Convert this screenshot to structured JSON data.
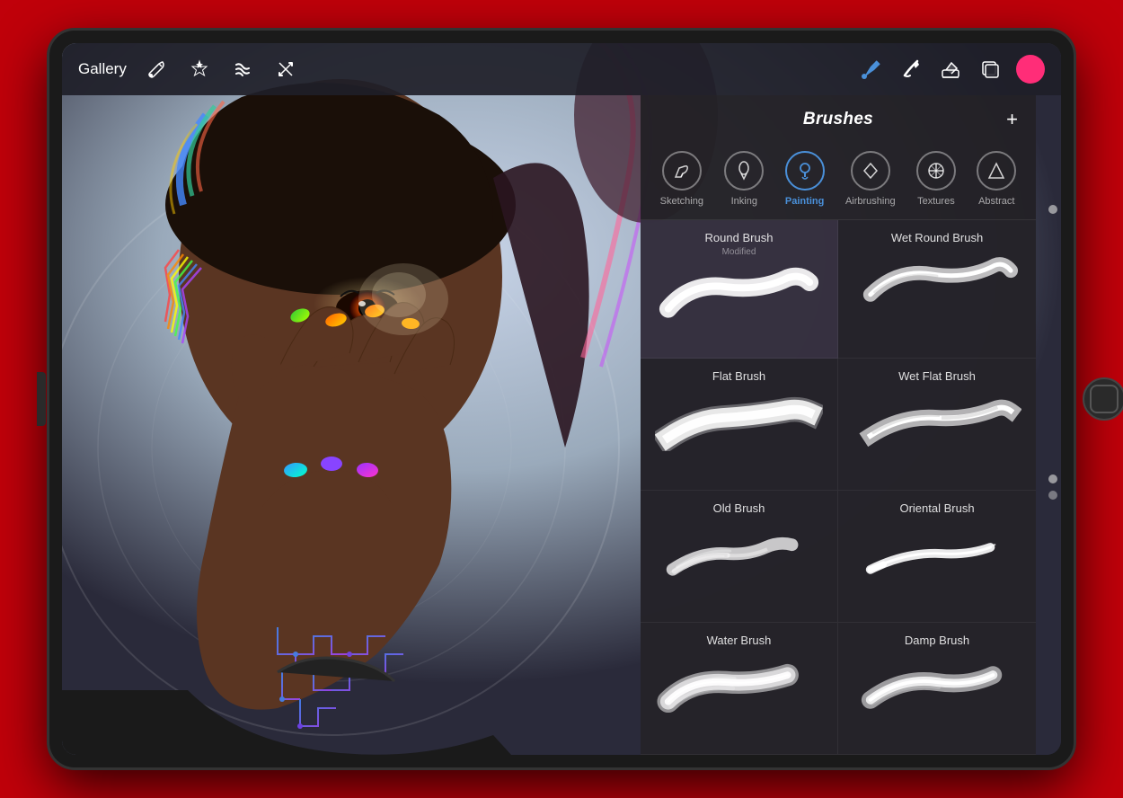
{
  "toolbar": {
    "gallery_label": "Gallery",
    "tools": [
      "wrench",
      "magic",
      "liquify",
      "transform"
    ],
    "right_tools": [
      "brush",
      "smudge",
      "eraser",
      "layers"
    ],
    "color_swatch": "#ff2d78",
    "brush_color": "#4a90d9"
  },
  "brushes_panel": {
    "title": "Brushes",
    "add_button": "+",
    "categories": [
      {
        "id": "sketching",
        "label": "Sketching",
        "active": false,
        "icon": "✏️"
      },
      {
        "id": "inking",
        "label": "Inking",
        "active": false,
        "icon": "🖊"
      },
      {
        "id": "painting",
        "label": "Painting",
        "active": true,
        "icon": "💧"
      },
      {
        "id": "airbrushing",
        "label": "Airbrushing",
        "active": false,
        "icon": "🔺"
      },
      {
        "id": "textures",
        "label": "Textures",
        "active": false,
        "icon": "✳"
      },
      {
        "id": "abstract",
        "label": "Abstract",
        "active": false,
        "icon": "△"
      }
    ],
    "brushes": [
      {
        "name": "Round Brush",
        "subtitle": "Modified",
        "selected": true,
        "col": 0
      },
      {
        "name": "Wet Round Brush",
        "subtitle": "",
        "selected": false,
        "col": 1
      },
      {
        "name": "Flat Brush",
        "subtitle": "",
        "selected": false,
        "col": 0
      },
      {
        "name": "Wet Flat Brush",
        "subtitle": "",
        "selected": false,
        "col": 1
      },
      {
        "name": "Old Brush",
        "subtitle": "",
        "selected": false,
        "col": 0
      },
      {
        "name": "Oriental Brush",
        "subtitle": "",
        "selected": false,
        "col": 1
      },
      {
        "name": "Water Brush",
        "subtitle": "",
        "selected": false,
        "col": 0
      },
      {
        "name": "Damp Brush",
        "subtitle": "",
        "selected": false,
        "col": 1
      }
    ]
  }
}
